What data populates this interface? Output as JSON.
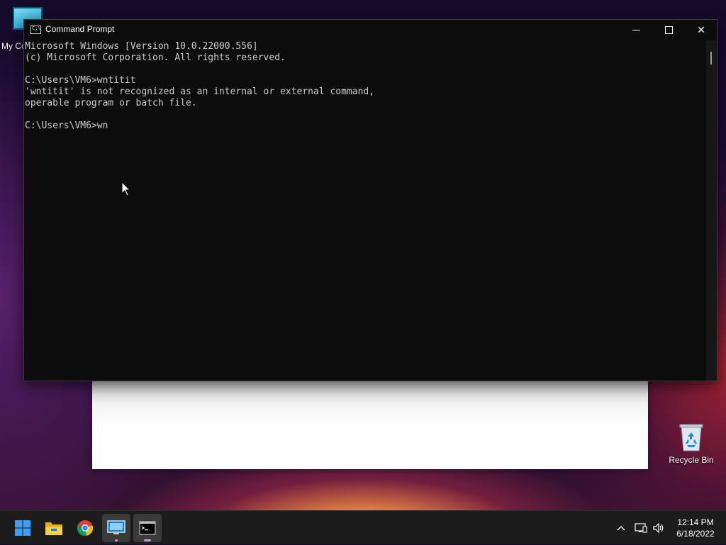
{
  "desktop": {
    "icons": [
      {
        "label": "My Co"
      },
      {
        "label": "Recycle Bin"
      }
    ]
  },
  "cmd_window": {
    "title": "Command Prompt",
    "icon": "cmd-icon",
    "app_icon_text": "C:\\",
    "controls": {
      "minimize": "minimize-icon",
      "maximize": "maximize-icon",
      "close": "close-icon",
      "close_glyph": "✕"
    },
    "lines": [
      "Microsoft Windows [Version 10.0.22000.556]",
      "(c) Microsoft Corporation. All rights reserved.",
      "",
      "C:\\Users\\VM6>wntitit",
      "'wntitit' is not recognized as an internal or external command,",
      "operable program or batch file.",
      "",
      "C:\\Users\\VM6>wn"
    ],
    "colors": {
      "background": "#0c0c0c",
      "text": "#cccccc"
    }
  },
  "taskbar": {
    "apps": [
      {
        "name": "Start",
        "icon": "windows-logo-icon"
      },
      {
        "name": "File Explorer",
        "icon": "folder-icon"
      },
      {
        "name": "Google Chrome",
        "icon": "chrome-icon"
      },
      {
        "name": "Remote Desktop",
        "icon": "remote-desktop-icon"
      },
      {
        "name": "Command Prompt",
        "icon": "cmd-icon"
      }
    ],
    "tray": {
      "chevron": "^",
      "time": "12:14 PM",
      "date": "6/18/2022"
    },
    "accent": "#c09ad8"
  }
}
